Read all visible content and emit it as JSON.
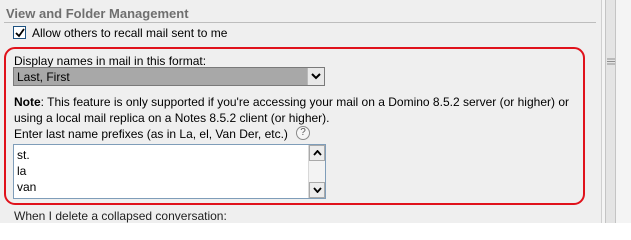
{
  "section": {
    "title": "View and Folder Management"
  },
  "recall": {
    "label": "Allow others to recall mail sent to me",
    "checked": true
  },
  "name_format": {
    "label": "Display names in mail in this format:",
    "selected": "Last, First"
  },
  "note": {
    "prefix": "Note",
    "text": ": This feature is only supported if you're accessing your mail on a Domino 8.5.2 server (or higher) or using a local mail replica on a Notes 8.5.2 client (or higher)."
  },
  "prefixes": {
    "label": "Enter last name prefixes (as in La, el, Van Der, etc.)",
    "help_icon": "?",
    "items": [
      "st.",
      "la",
      "van"
    ]
  },
  "collapsed": {
    "label": "When I delete a collapsed conversation:"
  },
  "colors": {
    "highlight_border": "#e0121b",
    "header_text": "#6f6f6f",
    "panel_bg": "#efefef"
  },
  "icons": {
    "checkbox_mark": "check-icon",
    "dropdown": "chevron-down-icon",
    "list_up": "arrow-up-icon",
    "list_down": "arrow-down-icon",
    "help": "help-icon",
    "scroll_grip": "grip-icon"
  }
}
